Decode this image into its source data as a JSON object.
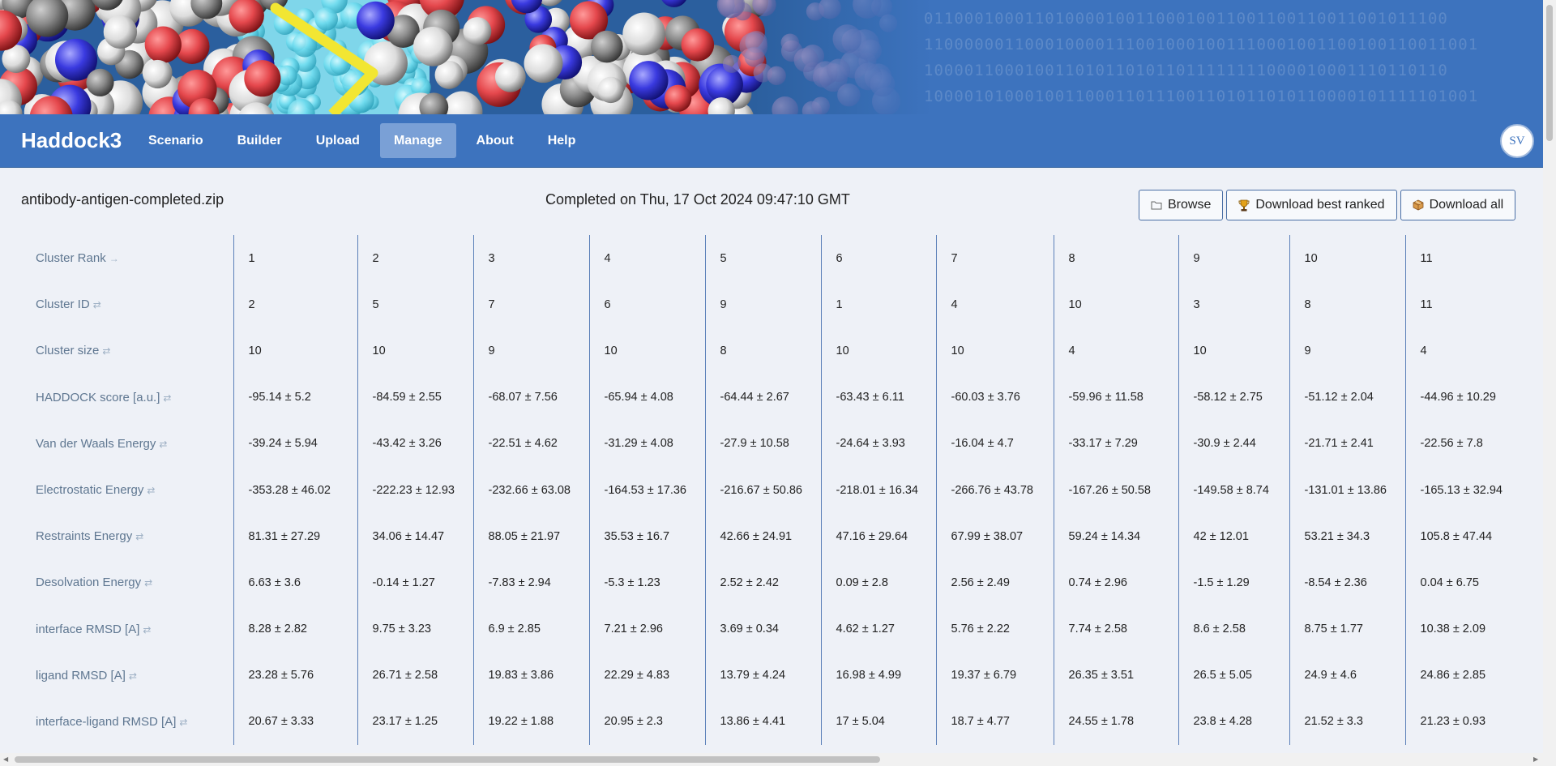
{
  "banner": {
    "binary_lines": [
      "0110001000110100001001100010011001100110011001011100",
      "1100000011000100001110010001001110001001100100110011001",
      "1000011000100110101101011011111111000010001110110110",
      "1000010100010011000110111001101011010110000101111101001"
    ]
  },
  "nav": {
    "brand": "Haddock3",
    "items": [
      "Scenario",
      "Builder",
      "Upload",
      "Manage",
      "About",
      "Help"
    ],
    "active": "Manage",
    "avatar": "SV"
  },
  "toolbar": {
    "filename": "antibody-antigen-completed.zip",
    "completed": "Completed on Thu, 17 Oct 2024 09:47:10 GMT",
    "browse": "Browse",
    "download_best": "Download best ranked",
    "download_all": "Download all"
  },
  "table": {
    "rows": [
      {
        "label": "Cluster Rank",
        "icon": "→",
        "values": [
          "1",
          "2",
          "3",
          "4",
          "5",
          "6",
          "7",
          "8",
          "9",
          "10",
          "11"
        ]
      },
      {
        "label": "Cluster ID",
        "icon": "⇄",
        "values": [
          "2",
          "5",
          "7",
          "6",
          "9",
          "1",
          "4",
          "10",
          "3",
          "8",
          "11"
        ]
      },
      {
        "label": "Cluster size",
        "icon": "⇄",
        "values": [
          "10",
          "10",
          "9",
          "10",
          "8",
          "10",
          "10",
          "4",
          "10",
          "9",
          "4"
        ]
      },
      {
        "label": "HADDOCK score [a.u.]",
        "icon": "⇄",
        "values": [
          "-95.14 ± 5.2",
          "-84.59 ± 2.55",
          "-68.07 ± 7.56",
          "-65.94 ± 4.08",
          "-64.44 ± 2.67",
          "-63.43 ± 6.11",
          "-60.03 ± 3.76",
          "-59.96 ± 11.58",
          "-58.12 ± 2.75",
          "-51.12 ± 2.04",
          "-44.96 ± 10.29"
        ]
      },
      {
        "label": "Van der Waals Energy",
        "icon": "⇄",
        "values": [
          "-39.24 ± 5.94",
          "-43.42 ± 3.26",
          "-22.51 ± 4.62",
          "-31.29 ± 4.08",
          "-27.9 ± 10.58",
          "-24.64 ± 3.93",
          "-16.04 ± 4.7",
          "-33.17 ± 7.29",
          "-30.9 ± 2.44",
          "-21.71 ± 2.41",
          "-22.56 ± 7.8"
        ]
      },
      {
        "label": "Electrostatic Energy",
        "icon": "⇄",
        "values": [
          "-353.28 ± 46.02",
          "-222.23 ± 12.93",
          "-232.66 ± 63.08",
          "-164.53 ± 17.36",
          "-216.67 ± 50.86",
          "-218.01 ± 16.34",
          "-266.76 ± 43.78",
          "-167.26 ± 50.58",
          "-149.58 ± 8.74",
          "-131.01 ± 13.86",
          "-165.13 ± 32.94"
        ]
      },
      {
        "label": "Restraints Energy",
        "icon": "⇄",
        "values": [
          "81.31 ± 27.29",
          "34.06 ± 14.47",
          "88.05 ± 21.97",
          "35.53 ± 16.7",
          "42.66 ± 24.91",
          "47.16 ± 29.64",
          "67.99 ± 38.07",
          "59.24 ± 14.34",
          "42 ± 12.01",
          "53.21 ± 34.3",
          "105.8 ± 47.44"
        ]
      },
      {
        "label": "Desolvation Energy",
        "icon": "⇄",
        "values": [
          "6.63 ± 3.6",
          "-0.14 ± 1.27",
          "-7.83 ± 2.94",
          "-5.3 ± 1.23",
          "2.52 ± 2.42",
          "0.09 ± 2.8",
          "2.56 ± 2.49",
          "0.74 ± 2.96",
          "-1.5 ± 1.29",
          "-8.54 ± 2.36",
          "0.04 ± 6.75"
        ]
      },
      {
        "label": "interface RMSD [A]",
        "icon": "⇄",
        "values": [
          "8.28 ± 2.82",
          "9.75 ± 3.23",
          "6.9 ± 2.85",
          "7.21 ± 2.96",
          "3.69 ± 0.34",
          "4.62 ± 1.27",
          "5.76 ± 2.22",
          "7.74 ± 2.58",
          "8.6 ± 2.58",
          "8.75 ± 1.77",
          "10.38 ± 2.09"
        ]
      },
      {
        "label": "ligand RMSD [A]",
        "icon": "⇄",
        "values": [
          "23.28 ± 5.76",
          "26.71 ± 2.58",
          "19.83 ± 3.86",
          "22.29 ± 4.83",
          "13.79 ± 4.24",
          "16.98 ± 4.99",
          "19.37 ± 6.79",
          "26.35 ± 3.51",
          "26.5 ± 5.05",
          "24.9 ± 4.6",
          "24.86 ± 2.85"
        ]
      },
      {
        "label": "interface-ligand RMSD [A]",
        "icon": "⇄",
        "values": [
          "20.67 ± 3.33",
          "23.17 ± 1.25",
          "19.22 ± 1.88",
          "20.95 ± 2.3",
          "13.86 ± 4.41",
          "17 ± 5.04",
          "18.7 ± 4.77",
          "24.55 ± 1.78",
          "23.8 ± 4.28",
          "21.52 ± 3.3",
          "21.23 ± 0.93"
        ]
      }
    ]
  }
}
